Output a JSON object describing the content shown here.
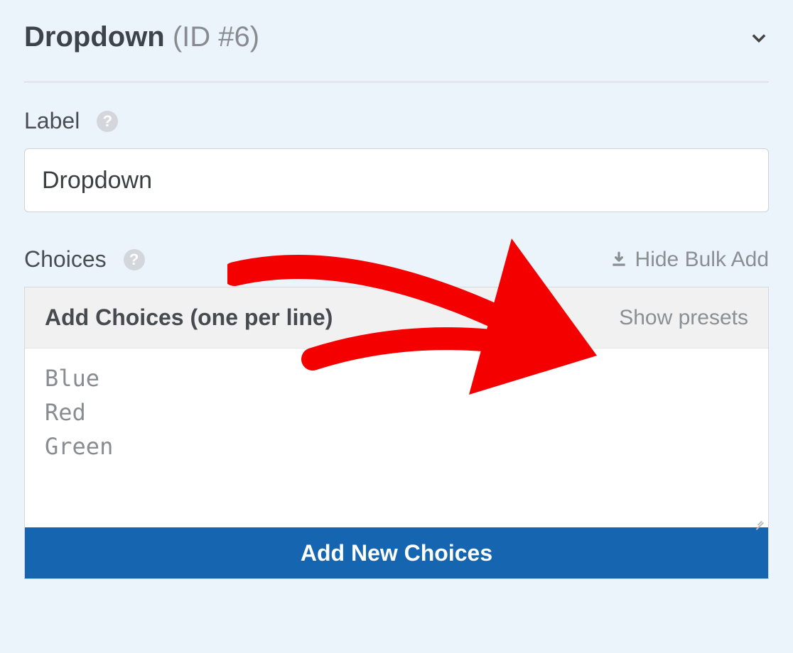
{
  "header": {
    "title": "Dropdown",
    "id_suffix": "(ID #6)"
  },
  "label_section": {
    "title": "Label",
    "value": "Dropdown"
  },
  "choices_section": {
    "title": "Choices",
    "hide_bulk_label": "Hide Bulk Add",
    "panel_title": "Add Choices (one per line)",
    "show_presets_label": "Show presets",
    "placeholder": "Blue\nRed\nGreen",
    "add_button_label": "Add New Choices"
  }
}
